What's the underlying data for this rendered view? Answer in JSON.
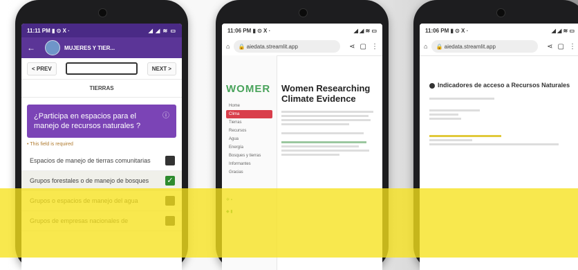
{
  "phone1": {
    "status_time": "11:11 PM ▮ ⊙ X ·",
    "status_right": "◢ ◢ ≋ ▭",
    "header_title": "MUJERES Y TIER...",
    "prev_label": "< PREV",
    "next_label": "NEXT >",
    "section_title": "TIERRAS",
    "question": "¿Participa en espacios para el manejo de recursos naturales ?",
    "required_note": "• This field is required",
    "options": [
      {
        "label": "Espacios de manejo de tierras comunitarias",
        "checked": false
      },
      {
        "label": "Grupos forestales o de manejo de bosques",
        "checked": true
      },
      {
        "label": "Grupos o espacios de manejo del agua",
        "checked": false
      },
      {
        "label": "Grupos de empresas nacionales de",
        "checked": false
      }
    ]
  },
  "phone2": {
    "status_time": "11:06 PM ▮ ⊙ X ·",
    "status_right": "◢ ◢ ≋ ▭",
    "url": "aiedata.streamlit.app",
    "logo": "WOMER",
    "menu": [
      "Home",
      "Clima",
      "Tierras",
      "Recursos",
      "Agua",
      "Energía",
      "Bosques y tierras",
      "Informantes",
      "Gracias"
    ],
    "main_title": "Women Researching Climate Evidence"
  },
  "phone3": {
    "status_time": "11:06 PM ▮ ⊙ X ·",
    "status_right": "◢ ◢ ≋ ▭",
    "url": "aiedata.streamlit.app",
    "main_title": "Indicadores de acceso a Recursos Naturales"
  }
}
